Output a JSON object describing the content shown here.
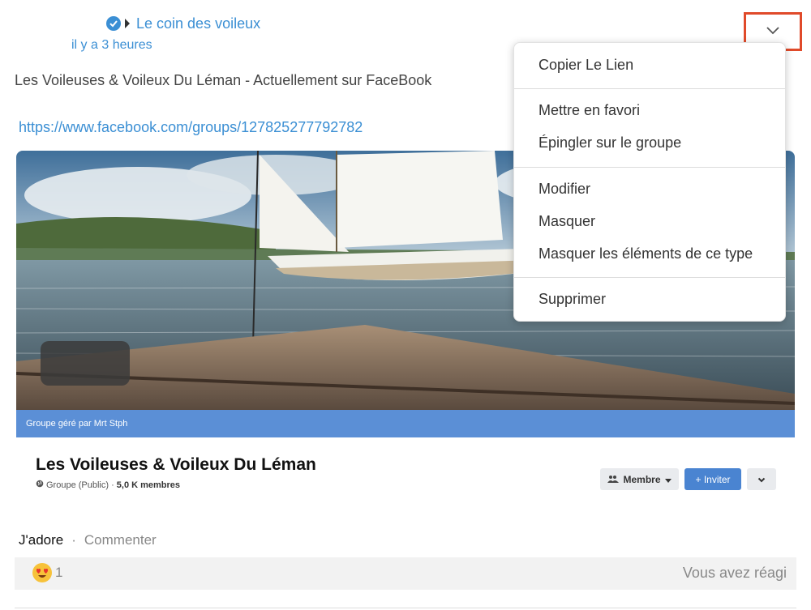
{
  "post": {
    "author": "Le coin des voileux",
    "time": "il y a 3 heures",
    "text": "Les Voileuses & Voileux Du Léman - Actuellement sur FaceBook",
    "url": "https://www.facebook.com/groups/127825277792782"
  },
  "card": {
    "banner_caption": "Groupe géré par Mrt Stph",
    "group_name": "Les Voileuses & Voileux Du Léman",
    "group_type": "Groupe (Public) ·",
    "members": "5,0 K membres",
    "membre_button": "Membre",
    "inviter_button": "+ Inviter"
  },
  "actions": {
    "like": "J'adore",
    "separator": "·",
    "comment": "Commenter"
  },
  "reactions": {
    "count": "1",
    "status": "Vous avez réagi"
  },
  "menu": {
    "items": [
      "Copier Le Lien",
      "Mettre en favori",
      "Épingler sur le groupe",
      "Modifier",
      "Masquer",
      "Masquer les éléments de ce type",
      "Supprimer"
    ]
  },
  "colors": {
    "link": "#3b8fd4",
    "highlight": "#e04a2a",
    "banner": "#5b8fd6",
    "invite_button": "#4a84d1"
  },
  "icons": {
    "verified": "verified-badge-icon",
    "author_arrow": "caret-right-icon",
    "options": "chevron-down-icon",
    "globe": "globe-icon",
    "members": "members-icon",
    "reaction": "heart-eyes-emoji-icon"
  }
}
